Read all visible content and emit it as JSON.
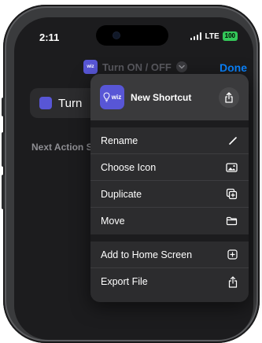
{
  "status_bar": {
    "time": "2:11",
    "network": "LTE",
    "battery": "100"
  },
  "navbar": {
    "title": "Turn ON / OFF",
    "done_label": "Done"
  },
  "editor": {
    "action_label": "Turn",
    "next_suggestions_label": "Next Action S"
  },
  "menu": {
    "header": {
      "icon_text": "wiz",
      "title": "New Shortcut"
    },
    "group1": [
      {
        "label": "Rename",
        "icon": "pencil-icon"
      },
      {
        "label": "Choose Icon",
        "icon": "photo-icon"
      },
      {
        "label": "Duplicate",
        "icon": "duplicate-icon"
      },
      {
        "label": "Move",
        "icon": "folder-icon"
      }
    ],
    "group2": [
      {
        "label": "Add to Home Screen",
        "icon": "plus-square-icon"
      },
      {
        "label": "Export File",
        "icon": "export-icon"
      }
    ]
  },
  "colors": {
    "accent": "#0a84ff",
    "wiz_brand": "#5856d6",
    "battery": "#34c759"
  }
}
